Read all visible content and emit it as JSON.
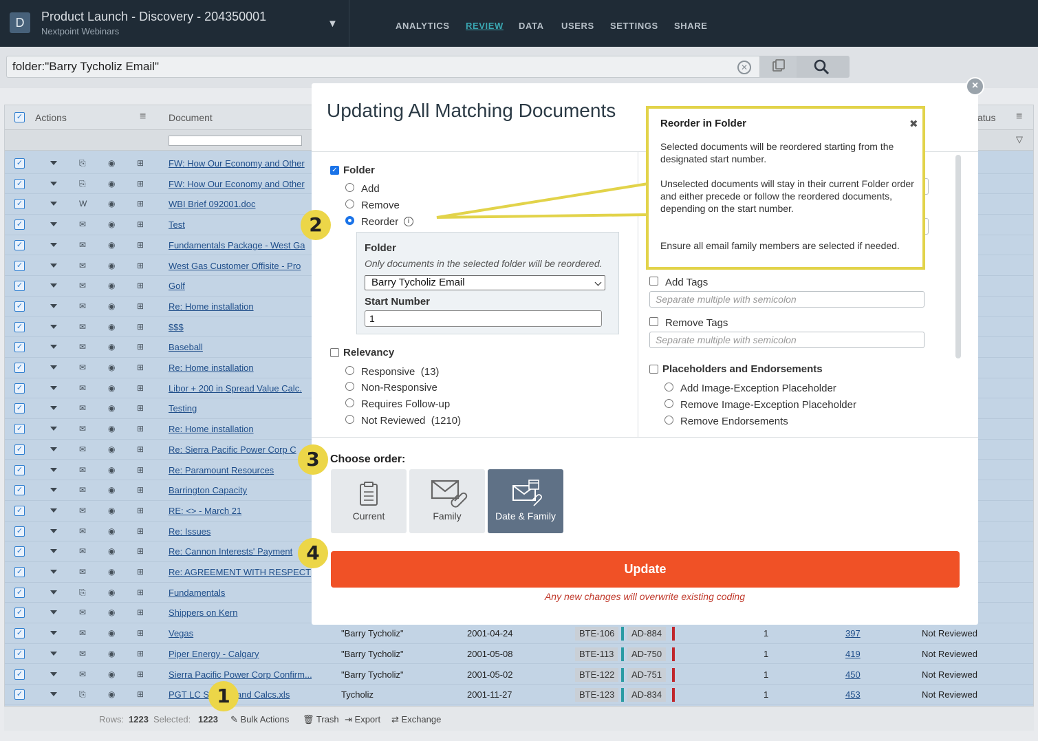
{
  "header": {
    "logo_letter": "D",
    "project_title": "Product Launch - Discovery - 204350001",
    "project_subtitle": "Nextpoint Webinars",
    "nav": [
      "ANALYTICS",
      "REVIEW",
      "DATA",
      "USERS",
      "SETTINGS",
      "SHARE"
    ],
    "active_nav": "REVIEW"
  },
  "search": {
    "query": "folder:\"Barry Tycholiz Email\""
  },
  "grid": {
    "headers": {
      "actions": "Actions",
      "document": "Document",
      "status": "atus"
    },
    "rows": [
      {
        "title": "FW: How Our Economy and Other",
        "icon": "attachment-icon"
      },
      {
        "title": "FW: How Our Economy and Other",
        "icon": "attachment-icon"
      },
      {
        "title": "WBI Brief 092001.doc",
        "icon": "word-doc-icon"
      },
      {
        "title": "Test",
        "icon": "email-icon"
      },
      {
        "title": "Fundamentals Package - West Ga",
        "icon": "email-icon"
      },
      {
        "title": "West Gas Customer Offisite - Pro",
        "icon": "email-icon"
      },
      {
        "title": "Golf",
        "icon": "email-icon"
      },
      {
        "title": "Re: Home installation",
        "icon": "email-icon"
      },
      {
        "title": "$$$",
        "icon": "email-icon"
      },
      {
        "title": "Baseball",
        "icon": "email-icon"
      },
      {
        "title": "Re: Home installation",
        "icon": "email-icon"
      },
      {
        "title": "Libor + 200 in Spread Value Calc.",
        "icon": "email-icon"
      },
      {
        "title": "Testing",
        "icon": "email-icon"
      },
      {
        "title": "Re: Home installation",
        "icon": "email-icon"
      },
      {
        "title": "Re: Sierra Pacific Power Corp C",
        "icon": "email-icon"
      },
      {
        "title": "Re: Paramount Resources",
        "icon": "email-icon"
      },
      {
        "title": "Barrington Capacity",
        "icon": "email-icon"
      },
      {
        "title": "RE: <> - March 21",
        "icon": "email-icon"
      },
      {
        "title": "Re: Issues",
        "icon": "email-icon"
      },
      {
        "title": "Re: Cannon Interests' Payment",
        "icon": "email-icon"
      },
      {
        "title": "Re: AGREEMENT WITH RESPECT",
        "icon": "email-icon"
      },
      {
        "title": "Fundamentals",
        "icon": "attachment-icon"
      },
      {
        "title": "Shippers on Kern",
        "icon": "email-icon"
      },
      {
        "title": "Vegas",
        "icon": "email-icon",
        "author": "\"Barry Tycholiz\"",
        "date": "2001-04-24",
        "bates_begin": "BTE-106",
        "bates_end": "AD-884",
        "pages": "1",
        "doc_no": "397",
        "review": "Not Reviewed"
      },
      {
        "title": "Piper Energy - Calgary",
        "icon": "email-icon",
        "author": "\"Barry Tycholiz\"",
        "date": "2001-05-08",
        "bates_begin": "BTE-113",
        "bates_end": "AD-750",
        "pages": "1",
        "doc_no": "419",
        "review": "Not Reviewed"
      },
      {
        "title": "Sierra Pacific Power Corp Confirm...",
        "icon": "email-icon",
        "author": "\"Barry Tycholiz\"",
        "date": "2001-05-02",
        "bates_begin": "BTE-122",
        "bates_end": "AD-751",
        "pages": "1",
        "doc_no": "450",
        "review": "Not Reviewed"
      },
      {
        "title": "PGT LC S",
        "icon": "attachment-icon",
        "title_tail": "and Calcs.xls",
        "author": "Tycholiz",
        "date": "2001-11-27",
        "bates_begin": "BTE-123",
        "bates_end": "AD-834",
        "pages": "1",
        "doc_no": "453",
        "review": "Not Reviewed"
      }
    ]
  },
  "footer": {
    "rows_label": "Rows:",
    "rows_value": "1223",
    "selected_label": "Selected:",
    "selected_value": "1223",
    "bulk_actions": "Bulk Actions",
    "trash": "Trash",
    "export": "Export",
    "exchange": "Exchange"
  },
  "modal": {
    "title": "Updating All Matching Documents",
    "folder": {
      "label": "Folder",
      "options": [
        "Add",
        "Remove",
        "Reorder"
      ],
      "selected": "Reorder",
      "box_title": "Folder",
      "box_hint": "Only documents in the selected folder will be reordered.",
      "folder_value": "Barry Tycholiz Email",
      "start_label": "Start Number",
      "start_value": "1"
    },
    "relevancy": {
      "label": "Relevancy",
      "options": [
        {
          "label": "Responsive",
          "count": "(13)"
        },
        {
          "label": "Non-Responsive",
          "count": ""
        },
        {
          "label": "Requires Follow-up",
          "count": ""
        },
        {
          "label": "Not Reviewed",
          "count": "(1210)"
        }
      ]
    },
    "right": {
      "add_tags": "Add Tags",
      "remove_tags": "Remove Tags",
      "tags_placeholder": "Separate multiple with semicolon",
      "placeholders_label": "Placeholders and Endorsements",
      "placeholder_options": [
        "Add Image-Exception Placeholder",
        "Remove Image-Exception Placeholder",
        "Remove Endorsements"
      ]
    },
    "choose_order": {
      "label": "Choose order:",
      "options": [
        "Current",
        "Family",
        "Date & Family"
      ],
      "selected": "Date & Family"
    },
    "update_label": "Update",
    "warning": "Any new changes will overwrite existing coding"
  },
  "tooltip": {
    "title": "Reorder in Folder",
    "p1": "Selected documents will be reordered starting from the designated start number.",
    "p2": "Unselected documents will stay in their current Folder order and either precede or follow the reordered documents, depending on the start number.",
    "p3": "Ensure all email family members are selected if needed."
  },
  "callouts": [
    "1",
    "2",
    "3",
    "4"
  ],
  "colors": {
    "accent": "#f05126",
    "highlight": "#e2d34a",
    "header_bg": "#1f2b36",
    "selected_order": "#5f7186",
    "link": "#1f4e8a"
  }
}
